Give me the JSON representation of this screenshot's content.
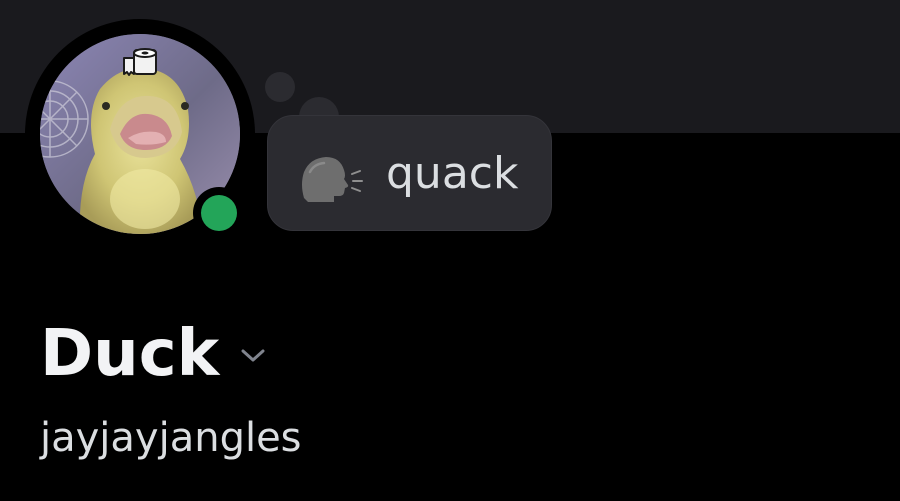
{
  "profile": {
    "display_name": "Duck",
    "username": "jayjayjangles",
    "avatar_icon": "duck-avatar",
    "avatar_decoration_icon": "toilet-paper-icon",
    "status_indicator": {
      "state": "online",
      "color": "#23a559"
    },
    "custom_status": {
      "emoji": "speaking-head-emoji",
      "text": "quack"
    },
    "dropdown_icon": "chevron-down-icon"
  },
  "theme": {
    "background": "#000000",
    "banner": "#1a1a1e",
    "bubble": "#2b2b30",
    "primary_text": "#f2f3f5",
    "secondary_text": "#dbdee1"
  }
}
